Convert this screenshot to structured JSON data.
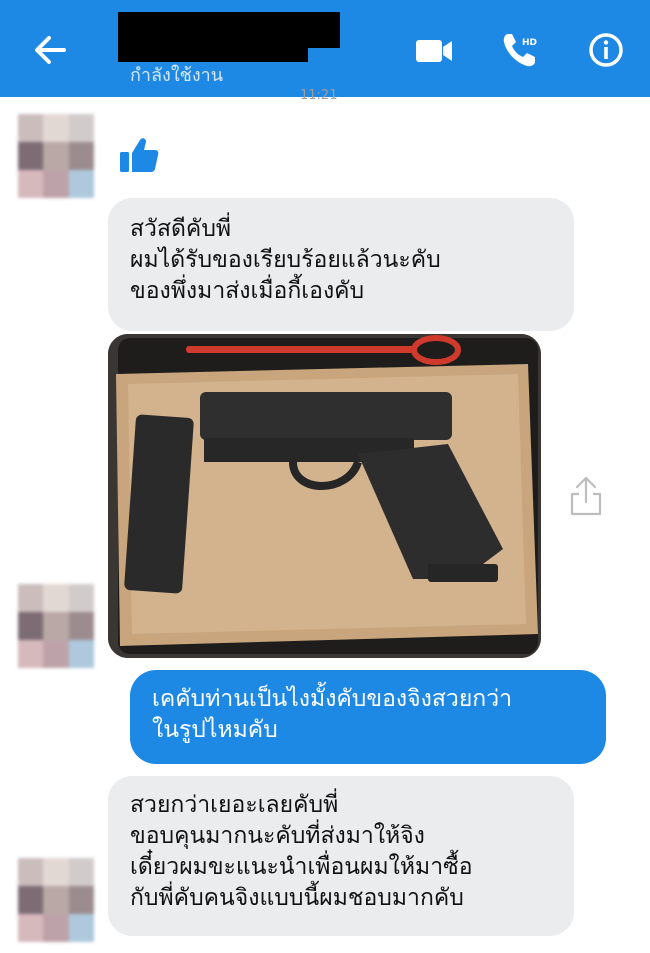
{
  "header": {
    "status_text": "กำลังใช้งาน",
    "timestamp": "11:21",
    "icons": [
      "back-arrow-icon",
      "video-call-icon",
      "phone-hd-icon",
      "info-icon"
    ],
    "hd_badge": "HD",
    "accent_color": "#1e88e5"
  },
  "messages": [
    {
      "sender": "them",
      "type": "like",
      "icon": "thumbs-up-icon"
    },
    {
      "sender": "them",
      "type": "text",
      "text": "สวัสดีคับพี่\nผมได้รับของเรียบร้อยแล้วนะคับ\nของพึ่งมาส่งเมื่อกี้เองคับ"
    },
    {
      "sender": "them",
      "type": "photo",
      "icon": "share-icon"
    },
    {
      "sender": "me",
      "type": "text",
      "text": "เคคับท่านเป็นไงมั้งคับของจิงสวยกว่า\nในรูปไหมคับ"
    },
    {
      "sender": "them",
      "type": "text",
      "text": "สวยกว่าเยอะเลยคับพี่\nขอบคุนมากนะคับที่ส่งมาให้จิง\nเดี๋ยวผมขะแนะนำเพื่อนผมให้มาซื้อ\nกับพี่คับคนจิงแบบนี้ผมชอบมากคับ"
    }
  ]
}
